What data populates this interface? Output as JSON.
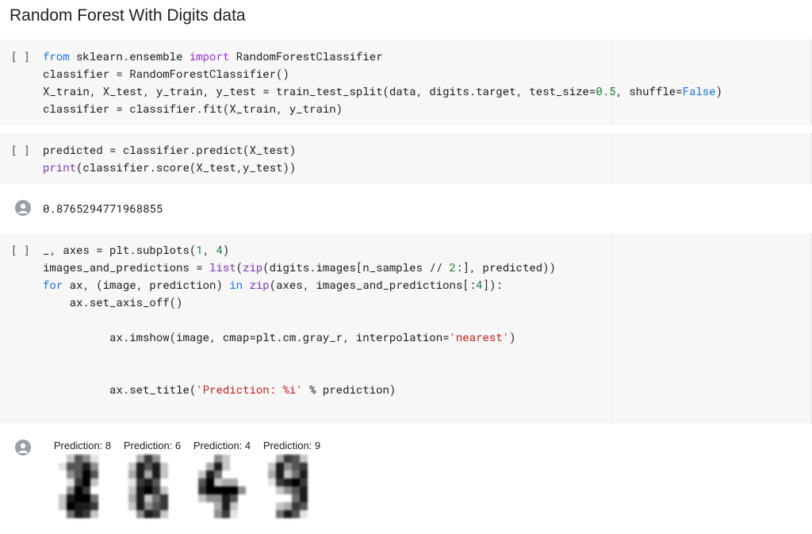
{
  "title": "Random Forest With Digits data",
  "indicator": "[ ]",
  "cells": {
    "c1": {
      "l1_from": "from",
      "l1_pkg": " sklearn.ensemble ",
      "l1_import": "import",
      "l1_cls": " RandomForestClassifier",
      "l2": "classifier = RandomForestClassifier()",
      "l3_a": "X_train, X_test, y_train, y_test = train_test_split(data, digits.target, test_size=",
      "l3_n1": "0.5",
      "l3_b": ", shuffle=",
      "l3_bool": "False",
      "l3_c": ")",
      "l4": "classifier = classifier.fit(X_train, y_train)"
    },
    "c2": {
      "l1": "predicted = classifier.predict(X_test)",
      "l2_print": "print",
      "l2_rest": "(classifier.score(X_test,y_test))"
    },
    "o2": "0.8765294771968855",
    "c3": {
      "l1_a": "_, axes = plt.subplots(",
      "l1_n1": "1",
      "l1_b": ", ",
      "l1_n2": "4",
      "l1_c": ")",
      "l2_a": "images_and_predictions = ",
      "l2_list": "list",
      "l2_b": "(",
      "l2_zip": "zip",
      "l2_c": "(digits.images[n_samples // ",
      "l2_n": "2",
      "l2_d": ":], predicted))",
      "l3_for": "for",
      "l3_a": " ax, (image, prediction) ",
      "l3_in": "in",
      "l3_b": " ",
      "l3_zip": "zip",
      "l3_c": "(axes, images_and_predictions[:",
      "l3_n": "4",
      "l3_d": "]):",
      "l4": "    ax.set_axis_off()",
      "l5_a": "    ax.imshow(image, cmap=plt.cm.gray_r, interpolation=",
      "l5_s": "'nearest'",
      "l5_b": ")",
      "l6_a": "    ax.set_title(",
      "l6_s": "'Prediction: %i'",
      "l6_b": " % prediction)"
    },
    "o3": {
      "pred1": "Prediction: 8",
      "pred2": "Prediction: 6",
      "pred3": "Prediction: 4",
      "pred4": "Prediction: 9"
    }
  },
  "chart_data": [
    {
      "type": "heatmap",
      "title": "Prediction: 8",
      "rows": 8,
      "cols": 8,
      "colormap": "gray_r",
      "values": [
        [
          0,
          0,
          2,
          6,
          4,
          1,
          0,
          0
        ],
        [
          0,
          1,
          6,
          6,
          8,
          4,
          0,
          0
        ],
        [
          0,
          0,
          4,
          6,
          9,
          6,
          0,
          0
        ],
        [
          0,
          0,
          1,
          7,
          9,
          2,
          0,
          0
        ],
        [
          0,
          0,
          4,
          9,
          7,
          0,
          0,
          0
        ],
        [
          0,
          2,
          8,
          9,
          9,
          5,
          0,
          0
        ],
        [
          0,
          2,
          9,
          8,
          8,
          7,
          0,
          0
        ],
        [
          0,
          0,
          5,
          8,
          7,
          2,
          0,
          0
        ]
      ]
    },
    {
      "type": "heatmap",
      "title": "Prediction: 6",
      "rows": 8,
      "cols": 8,
      "colormap": "gray_r",
      "values": [
        [
          0,
          0,
          3,
          7,
          4,
          0,
          0,
          0
        ],
        [
          0,
          2,
          8,
          6,
          8,
          2,
          0,
          0
        ],
        [
          0,
          3,
          8,
          3,
          8,
          2,
          0,
          0
        ],
        [
          0,
          1,
          7,
          8,
          6,
          0,
          0,
          0
        ],
        [
          0,
          2,
          8,
          9,
          7,
          2,
          0,
          0
        ],
        [
          0,
          3,
          8,
          2,
          5,
          7,
          0,
          0
        ],
        [
          0,
          2,
          8,
          4,
          6,
          7,
          0,
          0
        ],
        [
          0,
          0,
          4,
          8,
          7,
          2,
          0,
          0
        ]
      ]
    },
    {
      "type": "heatmap",
      "title": "Prediction: 4",
      "rows": 8,
      "cols": 8,
      "colormap": "gray_r",
      "values": [
        [
          0,
          0,
          0,
          4,
          2,
          0,
          0,
          0
        ],
        [
          0,
          0,
          3,
          8,
          2,
          0,
          0,
          0
        ],
        [
          0,
          2,
          8,
          5,
          0,
          0,
          0,
          0
        ],
        [
          0,
          6,
          9,
          2,
          3,
          3,
          0,
          0
        ],
        [
          0,
          7,
          9,
          9,
          9,
          9,
          4,
          0
        ],
        [
          0,
          2,
          4,
          4,
          8,
          6,
          0,
          0
        ],
        [
          0,
          0,
          0,
          3,
          8,
          2,
          0,
          0
        ],
        [
          0,
          0,
          0,
          4,
          7,
          1,
          0,
          0
        ]
      ]
    },
    {
      "type": "heatmap",
      "title": "Prediction: 9",
      "rows": 8,
      "cols": 8,
      "colormap": "gray_r",
      "values": [
        [
          0,
          0,
          3,
          7,
          6,
          2,
          0,
          0
        ],
        [
          0,
          2,
          8,
          4,
          6,
          7,
          0,
          0
        ],
        [
          0,
          3,
          8,
          2,
          5,
          8,
          0,
          0
        ],
        [
          0,
          1,
          7,
          8,
          9,
          7,
          0,
          0
        ],
        [
          0,
          0,
          2,
          4,
          6,
          8,
          0,
          0
        ],
        [
          0,
          0,
          0,
          0,
          5,
          8,
          0,
          0
        ],
        [
          0,
          0,
          2,
          3,
          7,
          6,
          0,
          0
        ],
        [
          0,
          0,
          5,
          8,
          6,
          1,
          0,
          0
        ]
      ]
    }
  ]
}
